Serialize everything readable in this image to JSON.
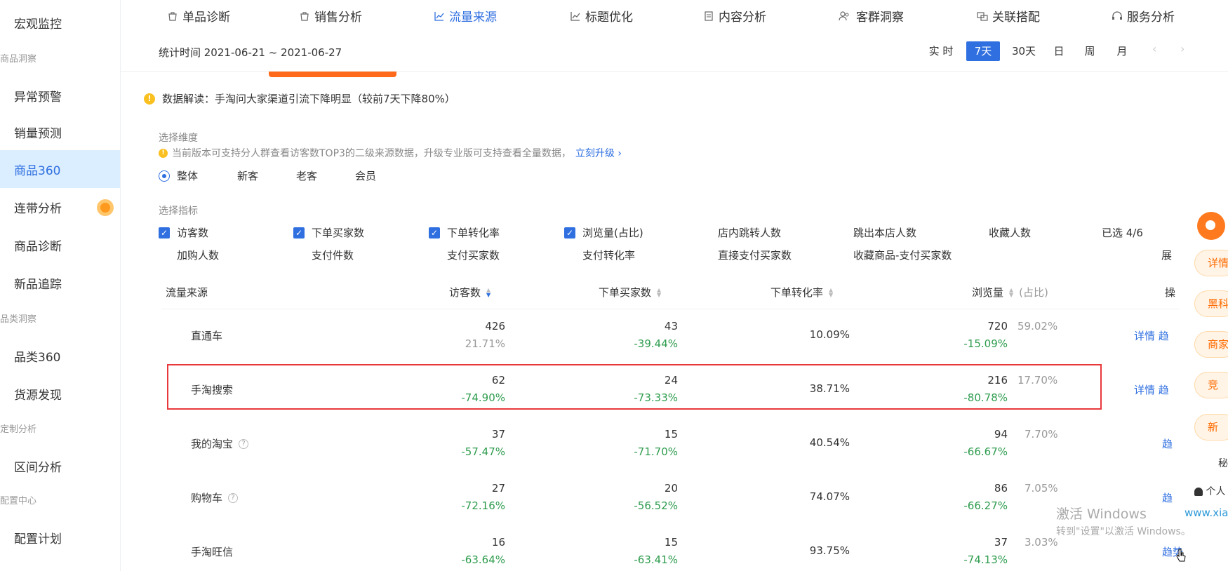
{
  "sidebar": {
    "items": [
      {
        "label": "宏观监控",
        "type": "item"
      },
      {
        "label": "商品洞察",
        "type": "group"
      },
      {
        "label": "异常预警",
        "type": "item"
      },
      {
        "label": "销量预测",
        "type": "item"
      },
      {
        "label": "商品360",
        "type": "item",
        "active": true
      },
      {
        "label": "连带分析",
        "type": "item",
        "badge": true
      },
      {
        "label": "商品诊断",
        "type": "item"
      },
      {
        "label": "新品追踪",
        "type": "item"
      },
      {
        "label": "品类洞察",
        "type": "group"
      },
      {
        "label": "品类360",
        "type": "item"
      },
      {
        "label": "货源发现",
        "type": "item"
      },
      {
        "label": "定制分析",
        "type": "group"
      },
      {
        "label": "区间分析",
        "type": "item"
      },
      {
        "label": "配置中心",
        "type": "group"
      },
      {
        "label": "配置计划",
        "type": "item"
      }
    ],
    "group_labels": {
      "g1": "商品洞察",
      "g2": "品类洞察",
      "g3": "定制分析",
      "g4": "配置中心"
    }
  },
  "topnav": {
    "tabs": [
      {
        "label": "单品诊断",
        "icon": "bag-icon"
      },
      {
        "label": "销售分析",
        "icon": "bag-icon"
      },
      {
        "label": "流量来源",
        "icon": "line-chart-icon",
        "active": true
      },
      {
        "label": "标题优化",
        "icon": "line-chart-icon"
      },
      {
        "label": "内容分析",
        "icon": "document-icon"
      },
      {
        "label": "客群洞察",
        "icon": "people-icon"
      },
      {
        "label": "关联搭配",
        "icon": "link-icon"
      },
      {
        "label": "服务分析",
        "icon": "headset-icon"
      }
    ]
  },
  "datebar": {
    "label": "统计时间 2021-06-21 ~ 2021-06-27",
    "ranges": [
      "实 时",
      "7天",
      "30天",
      "日",
      "周",
      "月"
    ],
    "active_range": "7天",
    "prev": "‹",
    "next": "›"
  },
  "insight": {
    "text": "数据解读：手淘问大家渠道引流下降明显（较前7天下降80%）"
  },
  "dimension": {
    "title": "选择维度",
    "hint": "当前版本可支持分人群查看访客数TOP3的二级来源数据，升级专业版可支持查看全量数据，",
    "hint_link": "立刻升级 ›",
    "options": [
      "整体",
      "新客",
      "老客",
      "会员"
    ],
    "selected": "整体"
  },
  "metrics": {
    "title": "选择指标",
    "row1": [
      {
        "label": "访客数",
        "checked": true
      },
      {
        "label": "下单买家数",
        "checked": true
      },
      {
        "label": "下单转化率",
        "checked": true
      },
      {
        "label": "浏览量(占比)",
        "checked": true
      },
      {
        "label": "店内跳转人数",
        "checked": false
      },
      {
        "label": "跳出本店人数",
        "checked": false
      },
      {
        "label": "收藏人数",
        "checked": false
      }
    ],
    "row2": [
      {
        "label": "加购人数",
        "checked": false
      },
      {
        "label": "支付件数",
        "checked": false
      },
      {
        "label": "支付买家数",
        "checked": false
      },
      {
        "label": "支付转化率",
        "checked": false
      },
      {
        "label": "直接支付买家数",
        "checked": false
      },
      {
        "label": "收藏商品-支付买家数",
        "checked": false
      }
    ],
    "selected_count": "已选 4/6",
    "expand": "展"
  },
  "table": {
    "headers": {
      "source": "流量来源",
      "visitors": "访客数",
      "buyers": "下单买家数",
      "conv": "下单转化率",
      "pv": "浏览量",
      "pv_sub": "(占比)",
      "op": "操"
    },
    "rows": [
      {
        "name": "直通车",
        "help": false,
        "visitors": "426",
        "visitors_pct": "21.71%",
        "buyers": "43",
        "buyers_pct": "-39.44%",
        "conv": "10.09%",
        "pv": "720",
        "pv_pct": "-15.09%",
        "share": "59.02%",
        "ops": "详情  趋"
      },
      {
        "name": "手淘搜索",
        "help": false,
        "visitors": "62",
        "visitors_pct": "-74.90%",
        "buyers": "24",
        "buyers_pct": "-73.33%",
        "conv": "38.71%",
        "pv": "216",
        "pv_pct": "-80.78%",
        "share": "17.70%",
        "ops": "详情  趋"
      },
      {
        "name": "我的淘宝",
        "help": true,
        "visitors": "37",
        "visitors_pct": "-57.47%",
        "buyers": "15",
        "buyers_pct": "-71.70%",
        "conv": "40.54%",
        "pv": "94",
        "pv_pct": "-66.67%",
        "share": "7.70%",
        "ops": "趋"
      },
      {
        "name": "购物车",
        "help": true,
        "visitors": "27",
        "visitors_pct": "-72.16%",
        "buyers": "20",
        "buyers_pct": "-56.52%",
        "conv": "74.07%",
        "pv": "86",
        "pv_pct": "-66.27%",
        "share": "7.05%",
        "ops": "趋"
      },
      {
        "name": "手淘旺信",
        "help": false,
        "visitors": "16",
        "visitors_pct": "-63.64%",
        "buyers": "15",
        "buyers_pct": "-63.41%",
        "conv": "93.75%",
        "pv": "37",
        "pv_pct": "-74.13%",
        "share": "3.03%",
        "ops": "趋势"
      }
    ]
  },
  "floating": {
    "pills": [
      "详情",
      "黑科",
      "商家",
      "竞",
      "新"
    ],
    "small1": "秘",
    "small2": "个人"
  },
  "watermark": {
    "line1": "激活 Windows",
    "line2": "转到\"设置\"以激活 Windows。",
    "site": "www.xia"
  },
  "colors": {
    "accent": "#2f6fe0",
    "negative_green": "#2e9c4e",
    "highlight_red": "#e8383c",
    "brand_orange": "#ff6a1a"
  }
}
